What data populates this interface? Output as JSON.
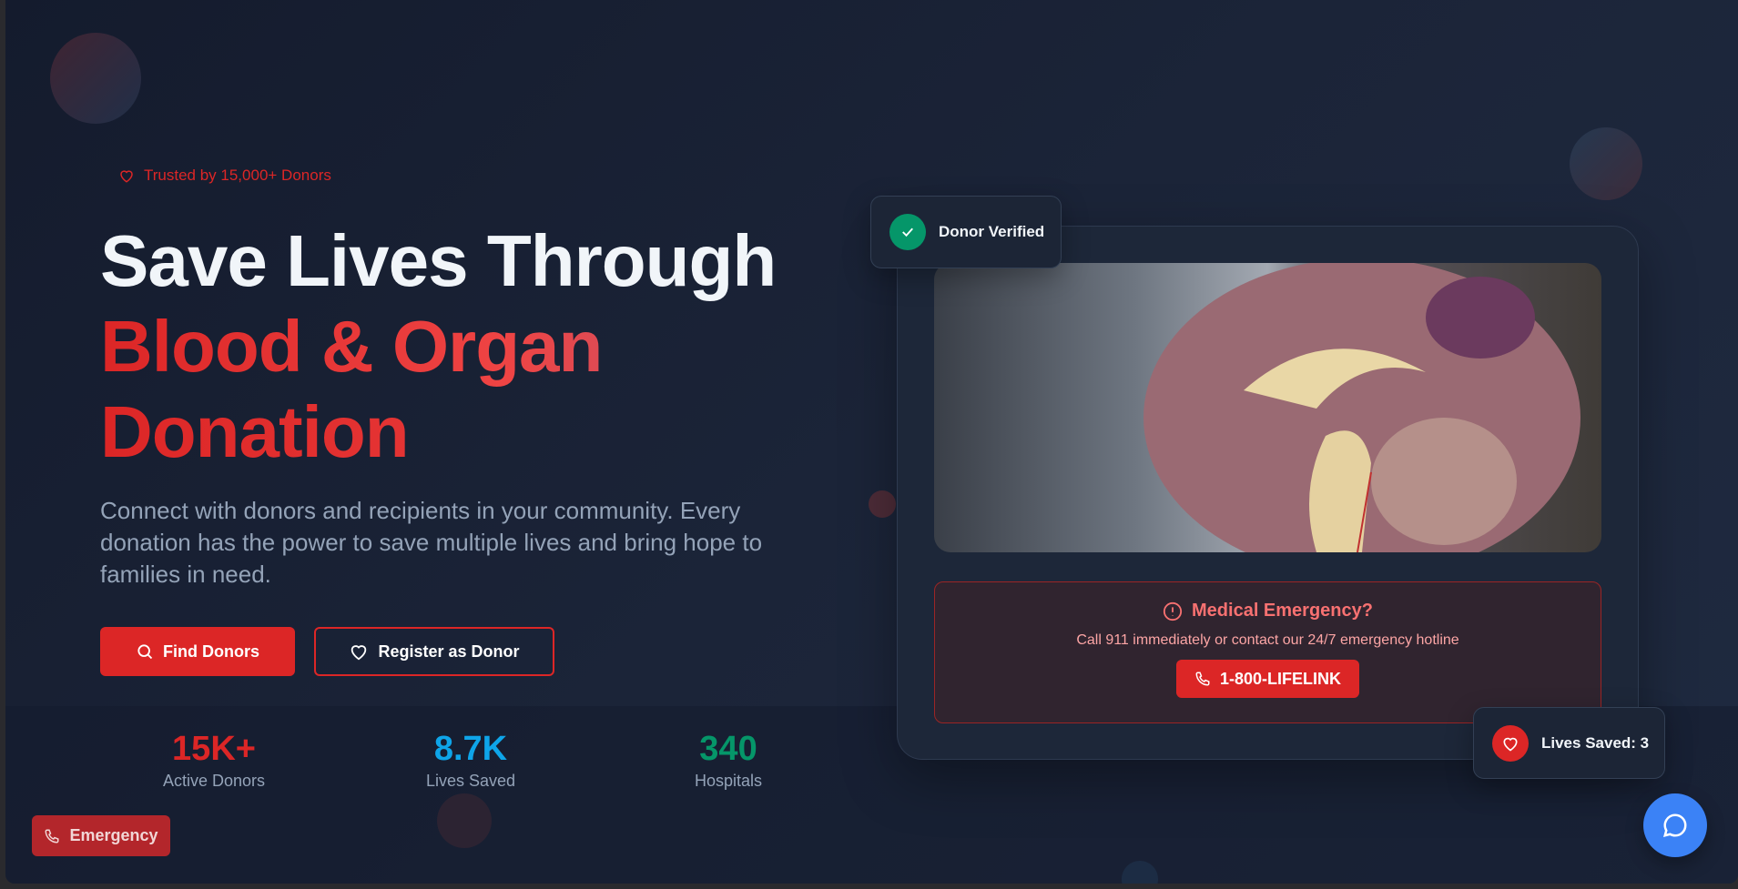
{
  "hero": {
    "trusted_badge": "Trusted by 15,000+ Donors",
    "title_line1": "Save Lives Through",
    "title_line2": "Blood & Organ",
    "title_line3": "Donation",
    "description": "Connect with donors and recipients in your community. Every donation has the power to save multiple lives and bring hope to families in need.",
    "find_donors_label": "Find Donors",
    "register_label": "Register as Donor"
  },
  "stats": [
    {
      "value": "15K+",
      "label": "Active Donors",
      "color": "#dc2626"
    },
    {
      "value": "8.7K",
      "label": "Lives Saved",
      "color": "#0ea5e9"
    },
    {
      "value": "340",
      "label": "Hospitals",
      "color": "#059669"
    }
  ],
  "emergency_button": "Emergency",
  "card": {
    "donor_verified": "Donor Verified",
    "emergency_title": "Medical Emergency?",
    "emergency_text": "Call 911 immediately or contact our 24/7 emergency hotline",
    "hotline": "1-800-LIFELINK",
    "lives_saved_badge": "Lives Saved: 3"
  },
  "icons": {
    "trusted": "heart-icon",
    "find": "search-icon",
    "register": "heart-icon",
    "emergency": "phone-icon",
    "verified": "check-icon",
    "alert": "alert-circle-icon",
    "chat": "chat-bubble-icon"
  },
  "colors": {
    "accent": "#dc2626",
    "success": "#059669",
    "info": "#0ea5e9",
    "chat": "#3b82f6"
  }
}
